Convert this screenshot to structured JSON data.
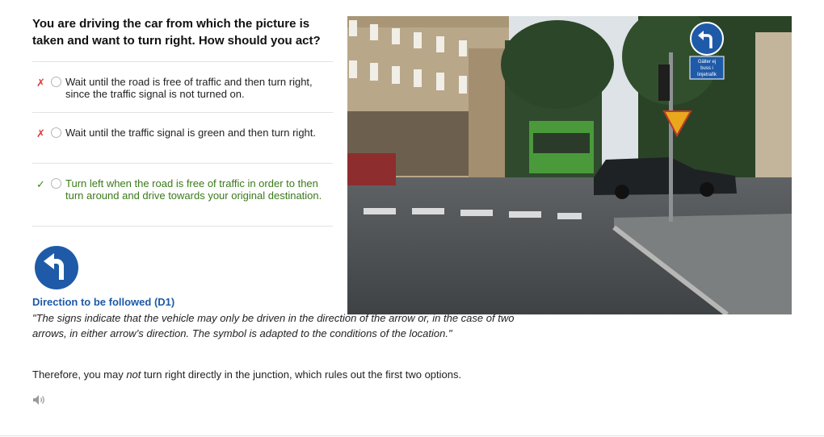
{
  "question": "You are driving the car from which the picture is taken and want to turn right. How should you act?",
  "options": [
    {
      "text": "Wait until the road is free of traffic and then turn right, since the traffic signal is not turned on.",
      "status": "wrong",
      "mark": "✗"
    },
    {
      "text": "Wait until the traffic signal is green and then turn right.",
      "status": "wrong",
      "mark": "✗"
    },
    {
      "text": "Turn left when the road is free of traffic in order to then turn around and drive towards your original destination.",
      "status": "correct",
      "mark": "✓"
    }
  ],
  "explanation": {
    "sign_title": "Direction to be followed (D1)",
    "quote": "\"The signs indicate that the vehicle may only be driven in the direction of the arrow or, in the case of two arrows, in either arrow’s direction. The symbol is adapted to the conditions of the location.\"",
    "conclusion_before": "Therefore, you may ",
    "conclusion_emphasis": "not",
    "conclusion_after": " turn right directly in the junction, which rules out the first two options."
  },
  "photo": {
    "sign_text_line1": "Gäller ej",
    "sign_text_line2": "buss i",
    "sign_text_line3": "linjetrafik"
  },
  "icons": {
    "sign": "direction-left-arrow-icon",
    "audio": "speaker-icon"
  },
  "colors": {
    "wrong": "#e03a3a",
    "correct": "#3a8a1e",
    "sign_blue": "#1e5aa8",
    "title_blue": "#1e5aa8"
  }
}
